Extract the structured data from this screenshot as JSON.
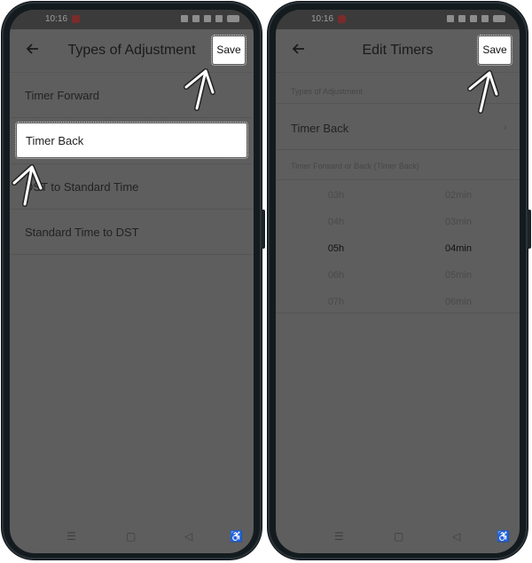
{
  "left_screen": {
    "status": {
      "time": "10:16"
    },
    "header": {
      "title": "Types of Adjustment",
      "save_label": "Save"
    },
    "list": [
      {
        "label": "Timer Forward",
        "selected": false
      },
      {
        "label": "Timer Back",
        "selected": true
      },
      {
        "label": "DST to Standard Time",
        "selected": false
      },
      {
        "label": "Standard Time to DST",
        "selected": false
      }
    ]
  },
  "right_screen": {
    "status": {
      "time": "10:16"
    },
    "header": {
      "title": "Edit Timers",
      "save_label": "Save"
    },
    "section1_label": "Types of Adjustment",
    "adjustment_value": "Timer Back",
    "chevron": "›",
    "section2_label": "Timer Forward or Back (Timer Back)",
    "picker": {
      "hours": [
        "03h",
        "04h",
        "05h",
        "06h",
        "07h"
      ],
      "minutes": [
        "02min",
        "03min",
        "04min",
        "05min",
        "06min"
      ],
      "selected_hour": "05h",
      "selected_minute": "04min"
    }
  },
  "navbar": {
    "menu_glyph": "☰",
    "home_glyph": "▢",
    "back_glyph": "◁",
    "accessibility_glyph": "♿"
  },
  "icons": {
    "back": "arrow-left-icon",
    "chevron": "chevron-right-icon",
    "accessibility": "accessibility-icon"
  },
  "colors": {
    "screen_dim": "#5e5e5e",
    "highlight": "#ffffff",
    "frame": "#141b1f"
  }
}
